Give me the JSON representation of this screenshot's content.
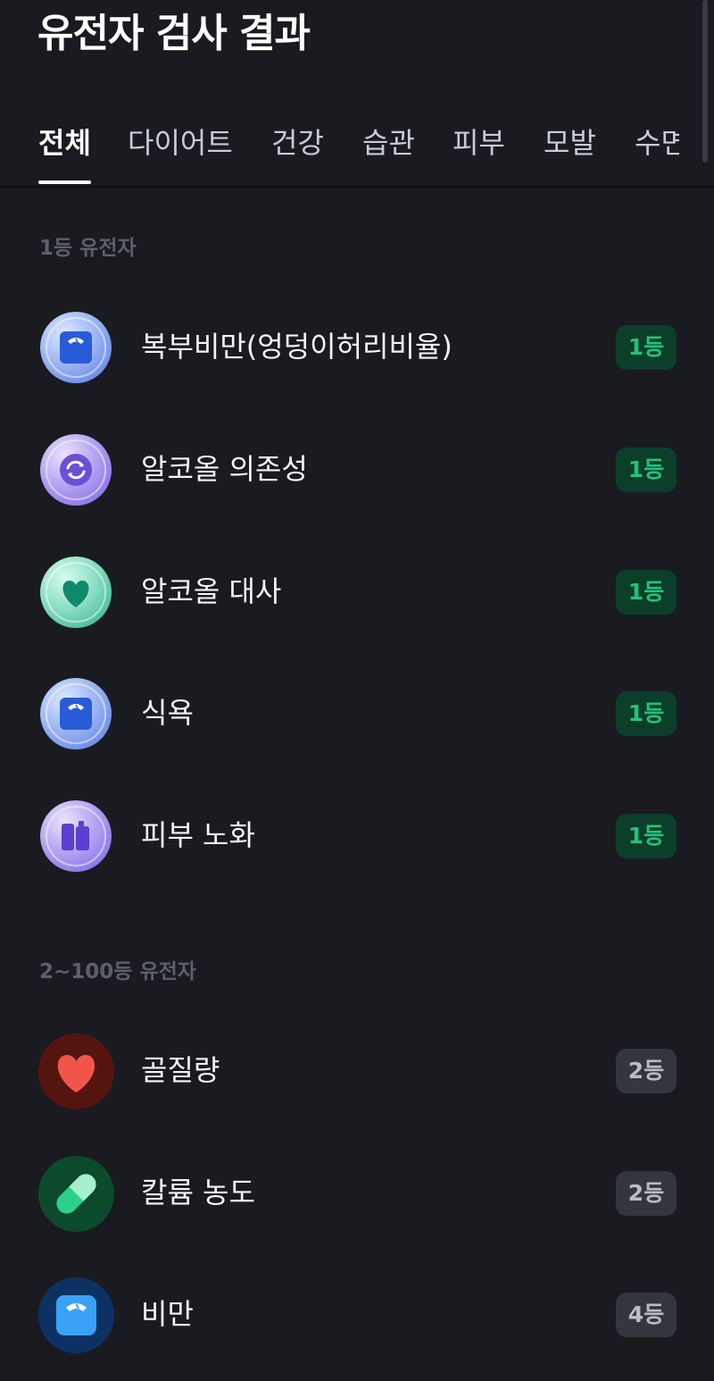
{
  "header": {
    "title": "유전자 검사 결과"
  },
  "tabs": [
    {
      "label": "전체",
      "active": true
    },
    {
      "label": "다이어트"
    },
    {
      "label": "건강"
    },
    {
      "label": "습관"
    },
    {
      "label": "피부"
    },
    {
      "label": "모발"
    },
    {
      "label": "수면"
    }
  ],
  "sections": [
    {
      "title": "1등 유전자",
      "items": [
        {
          "label": "복부비만(엉덩이허리비율)",
          "rank": "1등",
          "icon": "scale-icon"
        },
        {
          "label": "알코올 의존성",
          "rank": "1등",
          "icon": "refresh-icon"
        },
        {
          "label": "알코올 대사",
          "rank": "1등",
          "icon": "heart-icon"
        },
        {
          "label": "식욕",
          "rank": "1등",
          "icon": "scale-icon"
        },
        {
          "label": "피부 노화",
          "rank": "1등",
          "icon": "cosmetics-icon"
        }
      ]
    },
    {
      "title": "2~100등 유전자",
      "items": [
        {
          "label": "골질량",
          "rank": "2등",
          "icon": "heart-icon"
        },
        {
          "label": "칼륨 농도",
          "rank": "2등",
          "icon": "pill-icon"
        },
        {
          "label": "비만",
          "rank": "4등",
          "icon": "scale-icon"
        }
      ]
    }
  ],
  "colors": {
    "background": "#1a1b20",
    "rank_first_bg": "#0b3f2a",
    "rank_first_text": "#22c37a",
    "rank_other_bg": "#34363d",
    "rank_other_text": "#b9bcc3"
  }
}
